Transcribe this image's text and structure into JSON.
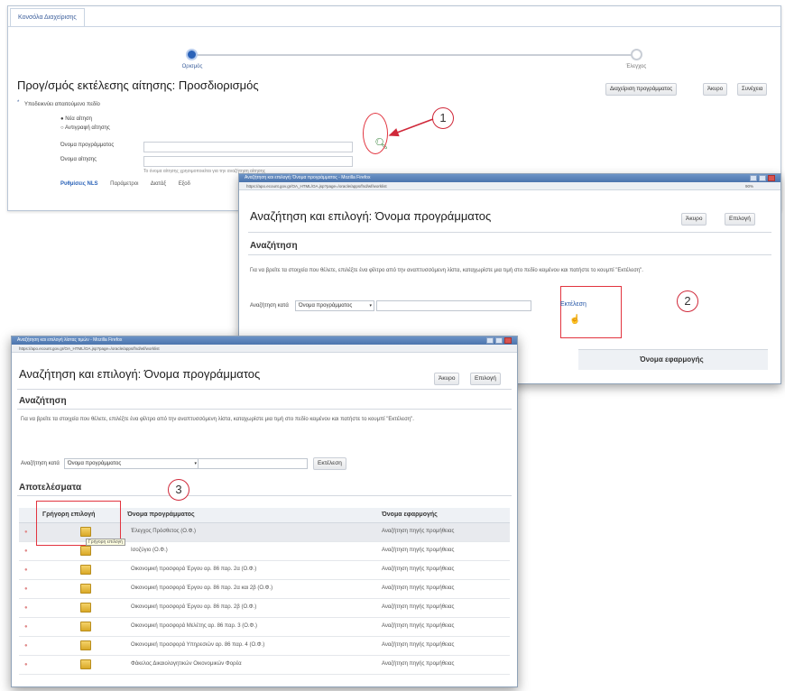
{
  "background_page": {
    "tab_label": "Κονσόλα Διαχείρισης",
    "train": {
      "step1_label": "Ορισμός",
      "step2_label": "Έλεγχος"
    },
    "title": "Προγ/σμός εκτέλεσης αίτησης: Προσδιορισμός",
    "buttons": {
      "schedule": "Διαχείριση προγράμματος",
      "cancel": "Άκυρο",
      "continue": "Συνέχεια"
    },
    "requirement_label": "Υποδεικνύει απαιτούμενο πεδίο",
    "radio_new": "Νέα αίτηση",
    "radio_copy": "Αντιγραφή αίτησης",
    "field_program": "Όνομα προγράμματος",
    "field_request": "Όνομα αίτησης",
    "hint": "Το όνομα αίτησης χρησιμοποιείται για την αναζήτηση αίτησης",
    "bottom_tabs": [
      "Ρυθμίσεις NLS",
      "Παράμετροι",
      "Διατάξ",
      "Εξοδ"
    ]
  },
  "markers": {
    "one": "1",
    "two": "2",
    "three": "3"
  },
  "dialog1": {
    "window_title": "Αναζήτηση και επιλογή: Όνομα προγράμματος - Mozilla Firefox",
    "url": "https://apo.ecount.gov.gr/OA_HTML/OA.jsp?page=/oracle/apps/fnd/wf/worklist",
    "zoom": "90%",
    "title": "Αναζήτηση και επιλογή: Όνομα προγράμματος",
    "cancel": "Άκυρο",
    "select": "Επιλογή",
    "search_heading": "Αναζήτηση",
    "instructions": "Για να βρείτε τα στοιχεία που θέλετε, επιλέξτε ένα φίλτρο από την αναπτυσσόμενη λίστα, καταχωρίστε μια τιμή στο πεδίο κειμένου και πατήστε το κουμπί \"Εκτέλεση\".",
    "search_by_label": "Αναζήτηση κατά",
    "search_by_value": "Όνομα προγράμματος",
    "run_button": "Εκτέλεση",
    "bottom_col": "Όνομα εφαρμογής"
  },
  "dialog2": {
    "window_title": "Αναζήτηση και επιλογή λίστας τιμών - Mozilla Firefox",
    "url": "https://apo.ecount.gov.gr/OA_HTML/OA.jsp?page=/oracle/apps/fnd/wf/worklist",
    "title": "Αναζήτηση και επιλογή: Όνομα προγράμματος",
    "cancel": "Άκυρο",
    "select": "Επιλογή",
    "search_heading": "Αναζήτηση",
    "instructions": "Για να βρείτε τα στοιχεία που θέλετε, επιλέξτε ένα φίλτρο από την αναπτυσσόμενη λίστα, καταχωρίστε μια τιμή στο πεδίο κειμένου και πατήστε το κουμπί \"Εκτέλεση\".",
    "search_by_label": "Αναζήτηση κατά",
    "search_by_value": "Όνομα προγράμματος",
    "run_button": "Εκτέλεση",
    "results_heading": "Αποτελέσματα",
    "columns": {
      "quick": "Γρήγορη επιλογή",
      "program": "Όνομα προγράμματος",
      "app": "Όνομα εφαρμογής"
    },
    "tooltip": "Γρήγορη επιλογή",
    "rows": [
      {
        "program": "Έλεγχος Πρόσθετος (Ο.Φ.)",
        "app": "Αναζήτηση πηγής προμήθειας"
      },
      {
        "program": "Ισοζύγιο (Ο.Φ.)",
        "app": "Αναζήτηση πηγής προμήθειας"
      },
      {
        "program": "Οικονομική προσφορά Έργου αρ. 86 παρ. 2α (Ο.Φ.)",
        "app": "Αναζήτηση πηγής προμήθειας"
      },
      {
        "program": "Οικονομική προσφορά Έργου αρ. 86 παρ. 2α και 2β (Ο.Φ.)",
        "app": "Αναζήτηση πηγής προμήθειας"
      },
      {
        "program": "Οικονομική προσφορά Έργου αρ. 86 παρ. 2β (Ο.Φ.)",
        "app": "Αναζήτηση πηγής προμήθειας"
      },
      {
        "program": "Οικονομική προσφορά Μελέτης αρ. 86 παρ. 3 (Ο.Φ.)",
        "app": "Αναζήτηση πηγής προμήθειας"
      },
      {
        "program": "Οικονομική προσφορά Υπηρεσιών αρ. 86 παρ. 4 (Ο.Φ.)",
        "app": "Αναζήτηση πηγής προμήθειας"
      },
      {
        "program": "Φάκελος Δικαιολογητικών Οικονομικών Φορέα",
        "app": "Αναζήτηση πηγής προμήθειας"
      }
    ]
  },
  "colors": {
    "accent": "#2a62b8",
    "annotation": "#d0293a"
  }
}
